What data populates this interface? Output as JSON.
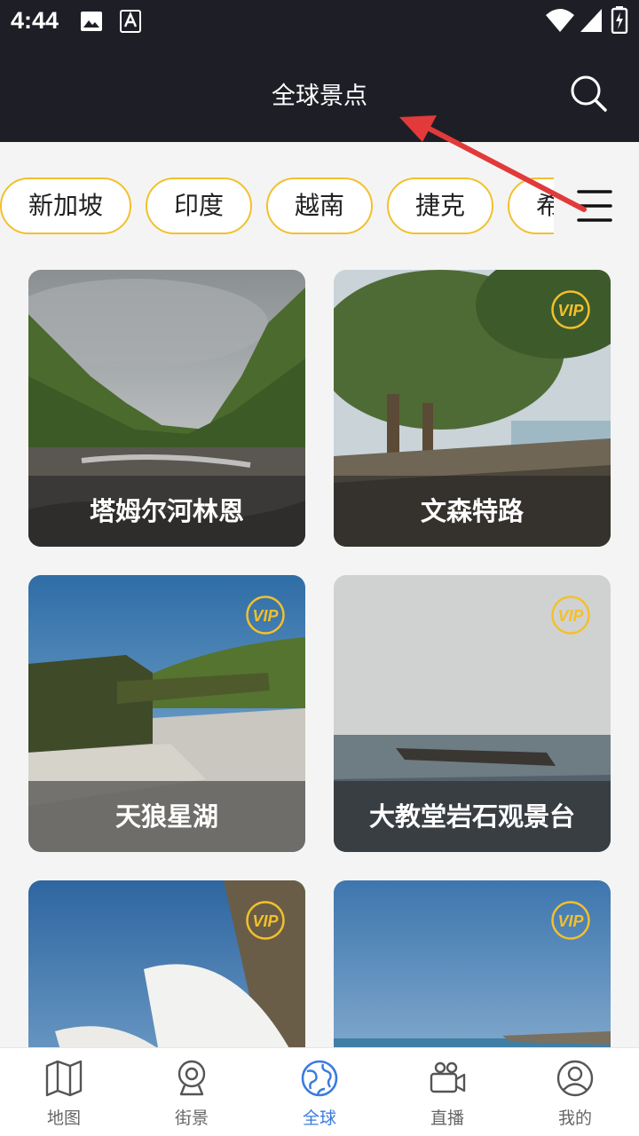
{
  "status": {
    "time": "4:44"
  },
  "header": {
    "title": "全球景点"
  },
  "chips": [
    "新加坡",
    "印度",
    "越南",
    "捷克",
    "希"
  ],
  "cards": [
    {
      "title": "塔姆尔河林恩",
      "vip": false
    },
    {
      "title": "文森特路",
      "vip": true
    },
    {
      "title": "天狼星湖",
      "vip": true
    },
    {
      "title": "大教堂岩石观景台",
      "vip": true
    },
    {
      "title": "",
      "vip": true
    },
    {
      "title": "",
      "vip": true
    }
  ],
  "nav": [
    {
      "label": "地图",
      "icon": "map-icon"
    },
    {
      "label": "街景",
      "icon": "street-view-icon"
    },
    {
      "label": "全球",
      "icon": "globe-icon",
      "active": true
    },
    {
      "label": "直播",
      "icon": "camera-icon"
    },
    {
      "label": "我的",
      "icon": "user-icon"
    }
  ],
  "colors": {
    "header_bg": "#1e1f26",
    "chip_border": "#f3c02b",
    "vip": "#f3c02b",
    "active_tab": "#3a7be0",
    "annotation_arrow": "#e23a3a"
  },
  "vip_label": "VIP"
}
